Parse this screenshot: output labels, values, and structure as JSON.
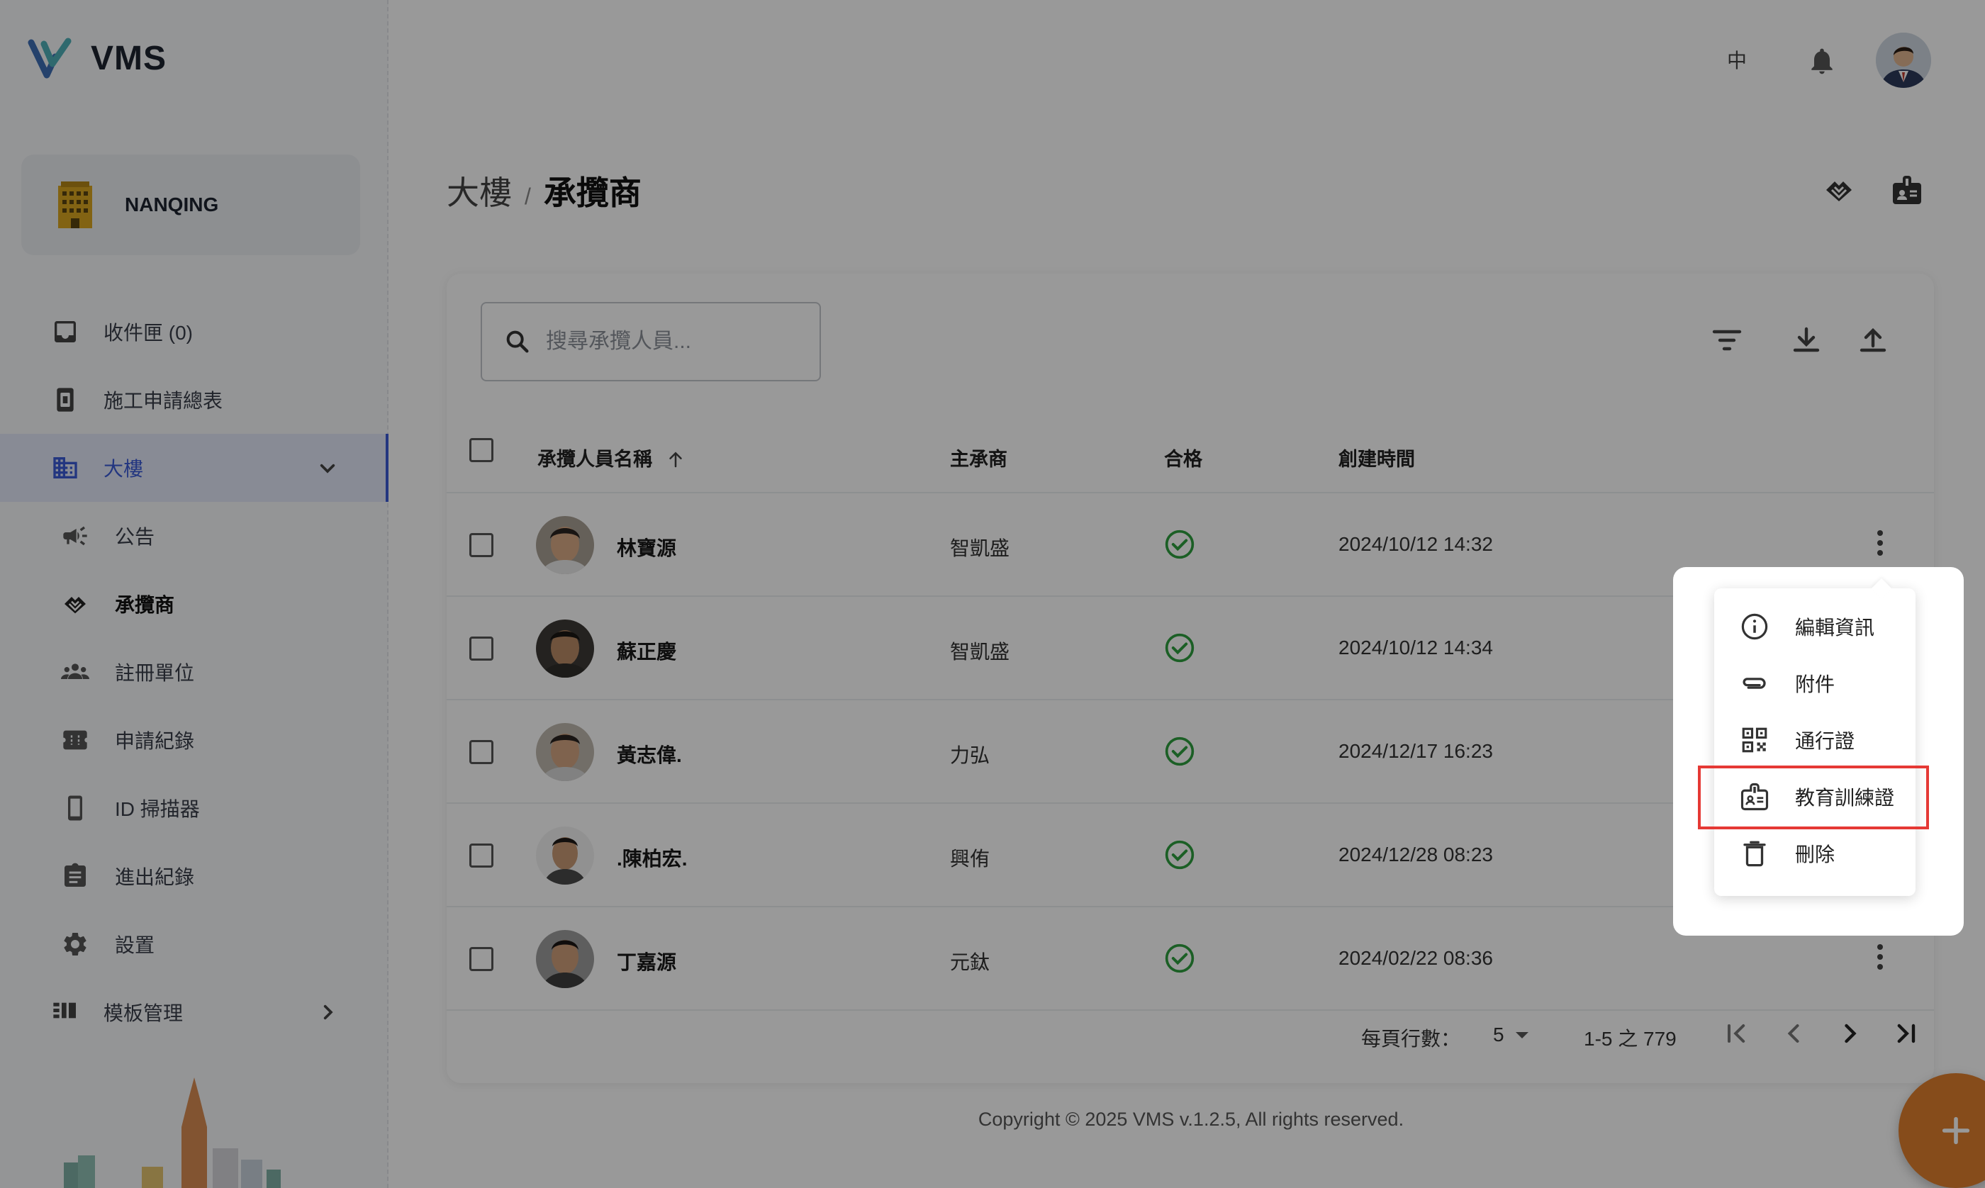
{
  "app": {
    "name": "VMS"
  },
  "org": {
    "name": "NANQING"
  },
  "sidebar": {
    "items": [
      {
        "label": "收件匣 (0)",
        "icon": "inbox-icon"
      },
      {
        "label": "施工申請總表",
        "icon": "document-icon"
      },
      {
        "label": "大樓",
        "icon": "building-icon",
        "expanded": true
      },
      {
        "label": "公告",
        "icon": "megaphone-icon"
      },
      {
        "label": "承攬商",
        "icon": "handshake-icon",
        "active": true
      },
      {
        "label": "註冊單位",
        "icon": "people-icon"
      },
      {
        "label": "申請紀錄",
        "icon": "ticket-icon"
      },
      {
        "label": "ID 掃描器",
        "icon": "phone-icon"
      },
      {
        "label": "進出紀錄",
        "icon": "clipboard-icon"
      },
      {
        "label": "設置",
        "icon": "gear-icon"
      },
      {
        "label": "模板管理",
        "icon": "template-icon"
      }
    ]
  },
  "topbar": {
    "lang": "中"
  },
  "breadcrumb": {
    "parent": "大樓",
    "separator": "/",
    "current": "承攬商"
  },
  "search": {
    "placeholder": "搜尋承攬人員..."
  },
  "table": {
    "headers": {
      "name": "承攬人員名稱",
      "contractor": "主承商",
      "qualified": "合格",
      "created": "創建時間"
    },
    "rows": [
      {
        "name": "林寶源",
        "contractor": "智凱盛",
        "qualified": true,
        "created": "2024/10/12 14:32"
      },
      {
        "name": "蘇正慶",
        "contractor": "智凱盛",
        "qualified": true,
        "created": "2024/10/12 14:34"
      },
      {
        "name": "黃志偉.",
        "contractor": "力弘",
        "qualified": true,
        "created": "2024/12/17 16:23"
      },
      {
        "name": ".陳柏宏.",
        "contractor": "興侑",
        "qualified": true,
        "created": "2024/12/28 08:23"
      },
      {
        "name": "丁嘉源",
        "contractor": "元鈦",
        "qualified": true,
        "created": "2024/02/22 08:36"
      }
    ]
  },
  "pagination": {
    "rows_per_page_label": "每頁行數：",
    "rows_per_page": "5",
    "range": "1-5 之 779"
  },
  "menu": {
    "items": [
      {
        "label": "編輯資訊",
        "icon": "info-icon"
      },
      {
        "label": "附件",
        "icon": "paperclip-icon"
      },
      {
        "label": "通行證",
        "icon": "qr-code-icon"
      },
      {
        "label": "教育訓練證",
        "icon": "badge-icon",
        "highlighted": true
      },
      {
        "label": "刪除",
        "icon": "trash-icon"
      }
    ]
  },
  "footer": {
    "copyright": "Copyright © 2025 VMS v.1.2.5, All rights reserved."
  },
  "colors": {
    "accent": "#3b5bd6",
    "fab": "#e07f2e",
    "ok": "#2e9e3e",
    "highlight": "#e53935"
  }
}
